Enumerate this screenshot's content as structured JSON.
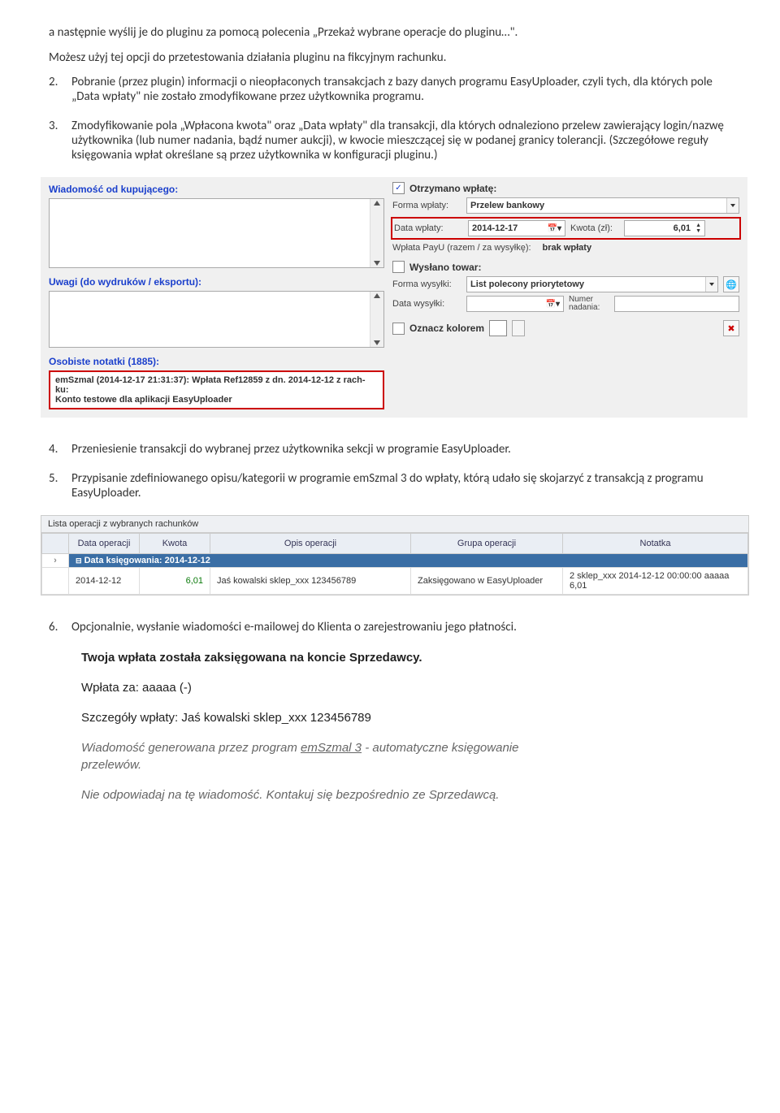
{
  "intro": {
    "p1": "a następnie wyślij je do pluginu za pomocą polecenia „Przekaż wybrane operacje do pluginu…\".",
    "p2": "Możesz użyj tej opcji do przetestowania działania pluginu na fikcyjnym rachunku."
  },
  "items": {
    "n2": "2.",
    "t2": "Pobranie (przez plugin) informacji o nieopłaconych transakcjach z bazy danych programu EasyUploader, czyli tych, dla których pole „Data wpłaty\" nie zostało zmodyfikowane przez użytkownika programu.",
    "n3": "3.",
    "t3": "Zmodyfikowanie pola „Wpłacona kwota\" oraz „Data wpłaty\" dla transakcji, dla których odnaleziono przelew zawierający login/nazwę użytkownika (lub numer nadania, bądź numer aukcji), w kwocie mieszczącej się w podanej granicy tolerancji. (Szczegółowe reguły księgowania wpłat określane są przez użytkownika w konfiguracji pluginu.)",
    "n4": "4.",
    "t4": "Przeniesienie transakcji do wybranej przez użytkownika sekcji w programie EasyUploader.",
    "n5": "5.",
    "t5": "Przypisanie zdefiniowanego opisu/kategorii  w programie emSzmal 3 do wpłaty, którą udało się skojarzyć z transakcją z programu EasyUploader.",
    "n6": "6.",
    "t6": "Opcjonalnie, wysłanie wiadomości e-mailowej do Klienta o zarejestrowaniu jego płatności."
  },
  "form": {
    "buyer_msg_label": "Wiadomość od kupującego:",
    "remarks_label": "Uwagi (do wydruków / eksportu):",
    "notes_label": "Osobiste notatki (1885):",
    "notes_line1": "emSzmal (2014-12-17 21:31:37): Wpłata Ref12859 z dn. 2014-12-12 z rach-ku:",
    "notes_line2": "Konto testowe dla aplikacji EasyUploader",
    "payment_received": "Otrzymano wpłatę:",
    "payment_form_label": "Forma wpłaty:",
    "payment_form_value": "Przelew bankowy",
    "payment_date_label": "Data wpłaty:",
    "payment_date_value": "2014-12-17",
    "amount_label": "Kwota (zł):",
    "amount_value": "6,01",
    "payu_label": "Wpłata PayU (razem / za wysyłkę):",
    "payu_value": "brak wpłaty",
    "shipped_label": "Wysłano towar:",
    "ship_form_label": "Forma wysyłki:",
    "ship_form_value": "List polecony priorytetowy",
    "ship_date_label": "Data wysyłki:",
    "tracking_label": "Numer nadania:",
    "color_label": "Oznacz kolorem"
  },
  "table": {
    "title": "Lista operacji z wybranych rachunków",
    "cols": [
      "Data operacji",
      "Kwota",
      "Opis operacji",
      "Grupa operacji",
      "Notatka"
    ],
    "group": "Data księgowania: 2014-12-12",
    "row": {
      "date": "2014-12-12",
      "amount": "6,01",
      "desc": "Jaś kowalski sklep_xxx 123456789",
      "group": "Zaksięgowano w EasyUploader",
      "note": "2 sklep_xxx  2014-12-12 00:00:00 aaaaa 6,01"
    }
  },
  "email": {
    "l1": "Twoja wpłata została zaksięgowana na koncie Sprzedawcy.",
    "l2": "Wpłata za: aaaaa (-)",
    "l3": "Szczegóły wpłaty: Jaś kowalski sklep_xxx 123456789",
    "l4a": "Wiadomość generowana przez program ",
    "l4b": "emSzmal 3",
    "l4c": " - automatyczne księgowanie przelewów.",
    "l5": "Nie odpowiadaj na tę wiadomość. Kontakuj się bezpośrednio ze Sprzedawcą."
  }
}
